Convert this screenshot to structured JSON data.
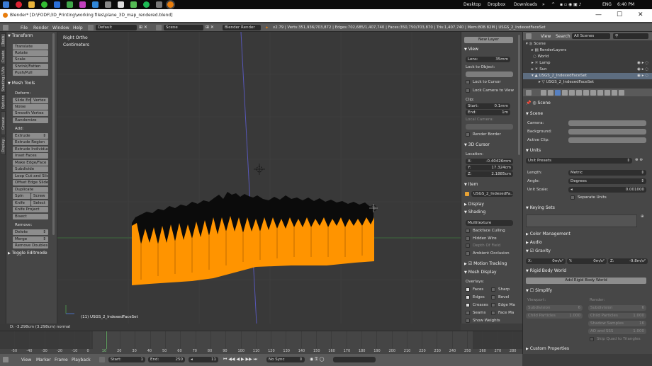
{
  "taskbar": {
    "items_right": [
      "Desktop",
      "Dropbox",
      "Downloads"
    ],
    "lang": "ENG",
    "clock": "6:40 PM"
  },
  "window": {
    "title": "Blender* [D:\\FODF\\3D_Printing\\working files\\plane_3D_map_rendered.blend]"
  },
  "info_header": {
    "menus": [
      "File",
      "Render",
      "Window",
      "Help"
    ],
    "layout": "Default",
    "scene": "Scene",
    "engine": "Blender Render",
    "stats": "v2.79 | Verts:351,936/703,872 | Edges:702,685/1,407,740 | Faces:350,750/703,870 | Tris:1,407,740 | Mem:808.82M | USGS_2_IndexedFaceSet"
  },
  "left_tabs": [
    "Tools",
    "Create",
    "Shading / UVs",
    "Options",
    "Grease Pencil",
    "Display"
  ],
  "toolshelf": {
    "transform_header": "Transform",
    "transform_buttons": [
      "Translate",
      "Rotate",
      "Scale",
      "Shrink/Fatten",
      "Push/Pull"
    ],
    "mesh_tools_header": "Mesh Tools",
    "deform_label": "Deform:",
    "slide_edge": "Slide Ed",
    "vertex": "Vertex",
    "deform_buttons": [
      "Noise",
      "Smooth Vertex",
      "Randomize"
    ],
    "add_label": "Add:",
    "extrude": "Extrude",
    "add_buttons": [
      "Extrude Region",
      "Extrude Individual",
      "Inset Faces",
      "Make Edge/Face",
      "Subdivide",
      "Loop Cut and Slide",
      "Offset Edge Slide",
      "Duplicate"
    ],
    "spin": "Spin",
    "screw": "Screw",
    "knife": "Knife",
    "select": "Select",
    "more_buttons": [
      "Knife Project",
      "Bisect"
    ],
    "remove_label": "Remove:",
    "delete": "Delete",
    "merge": "Merge",
    "remove_doubles": "Remove Doubles",
    "toggle_editmode": "Toggle Editmode"
  },
  "viewport": {
    "view_name": "Right Ortho",
    "units": "Centimeters",
    "object_label": "(11) USGS_2_IndexedFaceSet",
    "last_op": "D: -3.298cm (3.298cm) normal",
    "mesh_color": "#ff9400"
  },
  "npanel": {
    "new_layer": "New Layer",
    "view_header": "View",
    "lens_label": "Lens:",
    "lens_value": "35mm",
    "lock_to_object": "Lock to Object:",
    "lock_to_cursor": "Lock to Cursor",
    "lock_camera": "Lock Camera to View",
    "clip_label": "Clip:",
    "clip_start_label": "Start:",
    "clip_start_value": "0.1mm",
    "clip_end_label": "End:",
    "clip_end_value": "1m",
    "local_camera": "Local Camera:",
    "render_border": "Render Border",
    "cursor_header": "3D Cursor",
    "location_label": "Location:",
    "cursor_x": "-0.40426mm",
    "cursor_y": "17.324cm",
    "cursor_z": "2.1885cm",
    "item_header": "Item",
    "item_name": "USGS_2_IndexedFa...",
    "display_header": "Display",
    "shading_header": "Shading",
    "shading_mode": "Multitexture",
    "shading_options": [
      "Backface Culling",
      "Hidden Wire",
      "Depth Of Field",
      "Ambient Occlusion"
    ],
    "motion_tracking": "Motion Tracking",
    "mesh_display_header": "Mesh Display",
    "overlays_label": "Overlays:",
    "faces": "Faces",
    "sharp": "Sharp",
    "edges": "Edges",
    "bevel": "Bevel",
    "creases": "Creases",
    "edge_ma": "Edge Ma",
    "seams": "Seams",
    "face_ma": "Face Ma",
    "show_weights": "Show Weights"
  },
  "outliner": {
    "view": "View",
    "search": "Search",
    "filter": "All Scenes",
    "rows": [
      "Scene",
      "RenderLayers",
      "World",
      "Lamp",
      "Sun",
      "USGS_2_IndexedFaceSet",
      "USGS_2_IndexedFaceSet"
    ]
  },
  "properties": {
    "breadcrumb": "Scene",
    "scene_header": "Scene",
    "camera_label": "Camera:",
    "background_label": "Background:",
    "active_clip_label": "Active Clip:",
    "units_header": "Units",
    "unit_presets": "Unit Presets",
    "length_label": "Length:",
    "length_value": "Metric",
    "angle_label": "Angle:",
    "angle_value": "Degrees",
    "unit_scale_label": "Unit Scale:",
    "unit_scale_value": "0.001000",
    "separate_units": "Separate Units",
    "keying_sets_header": "Keying Sets",
    "color_mgmt_header": "Color Management",
    "audio_header": "Audio",
    "gravity_header": "Gravity",
    "grav_x_label": "X:",
    "grav_x_value": "0m/s²",
    "grav_y_label": "Y:",
    "grav_y_value": "0m/s²",
    "grav_z_label": "Z:",
    "grav_z_value": "-9.8m/s²",
    "rigid_body_world_header": "Rigid Body World",
    "add_rigid_body_world": "Add Rigid Body World",
    "simplify_header": "Simplify",
    "viewport_label": "Viewport:",
    "render_label": "Render:",
    "subdivision_label": "Subdivision",
    "subdivision_viewport": "6",
    "subdivision_render": "6",
    "child_particles_label": "Child Particles",
    "child_particles_viewport": "1.000",
    "child_particles_render": "1.000",
    "shadow_samples_label": "Shadow Samples",
    "shadow_samples_value": "16",
    "ao_sss_label": "AO and SSS",
    "ao_sss_value": "1.000",
    "skip_quad": "Skip Quad to Triangles",
    "custom_props_header": "Custom Properties"
  },
  "timeline": {
    "ticks": [
      "-50",
      "-40",
      "-30",
      "-20",
      "-10",
      "0",
      "10",
      "20",
      "30",
      "40",
      "50",
      "60",
      "70",
      "80",
      "90",
      "100",
      "110",
      "120",
      "130",
      "140",
      "150",
      "160",
      "170",
      "180",
      "190",
      "200",
      "210",
      "220",
      "230",
      "240",
      "250",
      "260",
      "270",
      "280"
    ],
    "current_frame": 11,
    "menus": [
      "View",
      "Marker",
      "Frame",
      "Playback"
    ],
    "start_label": "Start:",
    "start_value": "1",
    "end_label": "End:",
    "end_value": "250",
    "frame_value": "11",
    "sync": "No Sync"
  }
}
